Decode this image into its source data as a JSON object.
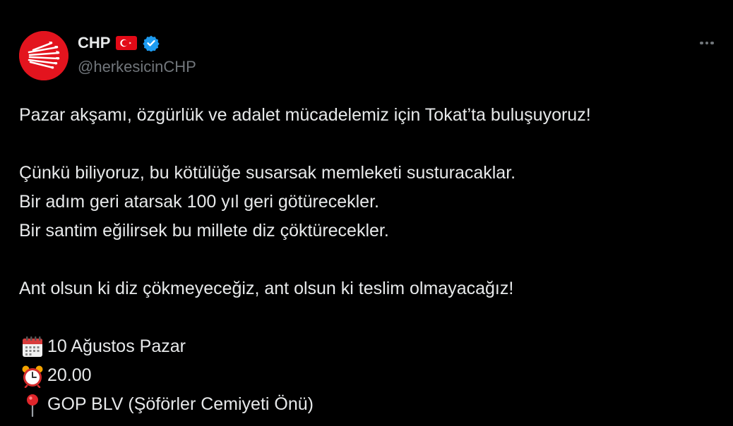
{
  "author": {
    "display_name": "CHP",
    "handle": "@herkesicinCHP",
    "avatar_icon": "chp-six-arrows-logo",
    "flag_icon": "turkey-flag-icon",
    "verified_icon": "verified-badge-icon",
    "brand_color": "#e3141e",
    "verified_color": "#1d9bf0"
  },
  "tweet": {
    "line1": "Pazar akşamı, özgürlük ve adalet mücadelemiz için Tokat’ta buluşuyoruz!",
    "line2": "Çünkü biliyoruz, bu kötülüğe susarsak memleketi susturacaklar.",
    "line3": "Bir adım geri atarsak 100 yıl geri götürecekler.",
    "line4": "Bir santim eğilirsek bu millete diz çöktürecekler.",
    "line5": "Ant olsun ki diz çökmeyeceğiz, ant olsun ki teslim olmayacağız!",
    "date": "10 Ağustos Pazar",
    "time": "20.00",
    "location": "GOP BLV (Şöförler Cemiyeti Önü)",
    "date_icon": "calendar-icon",
    "time_icon": "alarm-clock-icon",
    "location_icon": "pin-icon"
  },
  "more_icon": "more-options-icon"
}
